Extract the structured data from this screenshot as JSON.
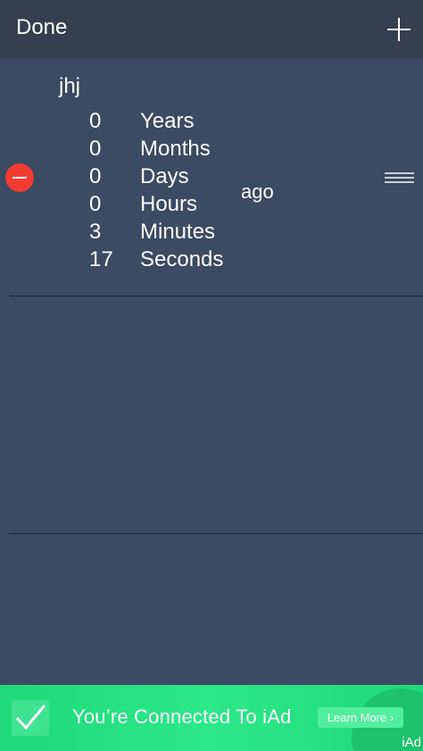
{
  "navbar": {
    "done_label": "Done",
    "add_icon": "plus-icon"
  },
  "items": [
    {
      "title": "jhj",
      "units": [
        {
          "value": "0",
          "label": "Years"
        },
        {
          "value": "0",
          "label": "Months"
        },
        {
          "value": "0",
          "label": "Days"
        },
        {
          "value": "0",
          "label": "Hours"
        },
        {
          "value": "3",
          "label": "Minutes"
        },
        {
          "value": "17",
          "label": "Seconds"
        }
      ],
      "suffix": "ago",
      "delete_icon": "minus-circle-icon",
      "reorder_icon": "reorder-handle-icon"
    }
  ],
  "ad": {
    "text": "You’re Connected To iAd",
    "button_label": "Learn More",
    "corner_label": "iAd",
    "check_icon": "checkmark-icon"
  },
  "colors": {
    "background": "#3a4b62",
    "navbar": "#343f4f",
    "delete": "#f23b30",
    "ad_green": "#1fd97a"
  }
}
